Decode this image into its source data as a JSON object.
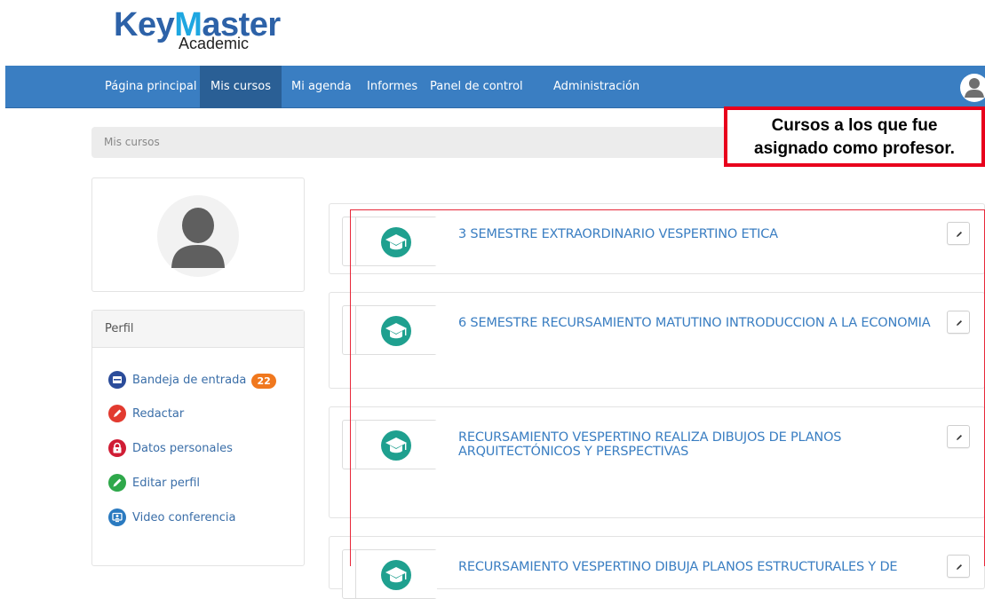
{
  "logo": {
    "main_prefix": "Key",
    "main_m": "M",
    "main_suffix": "aster",
    "sub": "Academic"
  },
  "navbar": {
    "items": [
      {
        "label": "Página principal",
        "active": false
      },
      {
        "label": "Mis cursos",
        "active": true
      },
      {
        "label": "Mi agenda",
        "active": false
      },
      {
        "label": "Informes",
        "active": false
      },
      {
        "label": "Panel de control",
        "active": false
      },
      {
        "label": "Administración",
        "active": false
      }
    ],
    "avatar_icon": "user-avatar-icon"
  },
  "breadcrumb": {
    "current": "Mis cursos"
  },
  "annotation": {
    "line1": "Cursos a los que fue",
    "line2": "asignado como profesor."
  },
  "sidebar": {
    "profile_avatar_icon": "user-silhouette-icon",
    "menu_title": "Perfil",
    "items": [
      {
        "label": "Bandeja de entrada",
        "icon": "inbox-icon",
        "color": "#2b4c9a",
        "badge": "22"
      },
      {
        "label": "Redactar",
        "icon": "pencil-icon",
        "color": "#e23a2f",
        "badge": ""
      },
      {
        "label": "Datos personales",
        "icon": "lock-icon",
        "color": "#d01d35",
        "badge": ""
      },
      {
        "label": "Editar perfil",
        "icon": "edit-icon",
        "color": "#2ea84a",
        "badge": ""
      },
      {
        "label": "Video conferencia",
        "icon": "video-conference-icon",
        "color": "#2a7ac0",
        "badge": ""
      }
    ]
  },
  "courses": [
    {
      "title": "3 SEMESTRE EXTRAORDINARIO VESPERTINO ETICA",
      "icon": "graduation-cap-icon"
    },
    {
      "title": "6 SEMESTRE RECURSAMIENTO MATUTINO INTRODUCCION A LA ECONOMIA",
      "icon": "graduation-cap-icon"
    },
    {
      "title": "RECURSAMIENTO VESPERTINO REALIZA DIBUJOS DE PLANOS ARQUITECTÓNICOS Y PERSPECTIVAS",
      "icon": "graduation-cap-icon"
    },
    {
      "title": "RECURSAMIENTO VESPERTINO DIBUJA PLANOS ESTRUCTURALES Y DE",
      "icon": "graduation-cap-icon"
    }
  ],
  "colors": {
    "navbar": "#3a7ec2",
    "navbar_active": "#2a5f95",
    "course_icon": "#1fa08f",
    "link": "#3a7ec2",
    "annotation_border": "#e8001c",
    "badge": "#f0781e"
  }
}
